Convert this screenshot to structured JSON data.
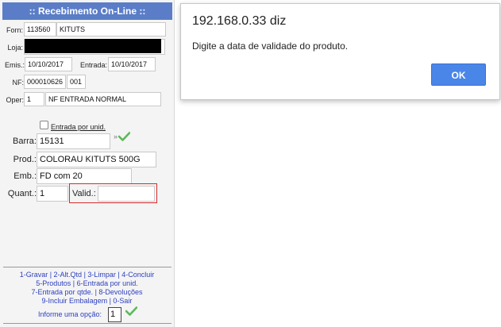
{
  "window": {
    "title": ":: Recebimento On-Line ::"
  },
  "header": {
    "forn_label": "Forn:",
    "forn_code": "113560",
    "forn_name": "KITUTS",
    "loja_label": "Loja:",
    "emis_label": "Emis.:",
    "emis_value": "10/10/2017",
    "entrada_label": "Entrada:",
    "entrada_value": "10/10/2017",
    "nf_label": "NF:",
    "nf_value": "000010626",
    "nf_serie": "001",
    "oper_label": "Oper:",
    "oper_code": "1",
    "oper_name": "NF ENTRADA NORMAL"
  },
  "form": {
    "entrada_unid_label": "Entrada por unid.",
    "entrada_unid_checked": false,
    "barra_label": "Barra:",
    "barra_value": "15131",
    "barra_marker": "»",
    "prod_label": "Prod.:",
    "prod_value": "COLORAU KITUTS 500G",
    "emb_label": "Emb.:",
    "emb_value": "FD com 20",
    "quant_label": "Quant.:",
    "quant_value": "1",
    "valid_label": "Valid.:",
    "valid_value": ""
  },
  "menu": {
    "line1": "1-Gravar | 2-Alt.Qtd | 3-Limpar | 4-Concluir",
    "line2": "5-Produtos | 6-Entrada por unid.",
    "line3": "7-Entrada por qtde. | 8-Devoluções",
    "line4": "9-Incluir Embalagem | 0-Sair",
    "prompt_label": "Informe uma opção:",
    "option_value": "1"
  },
  "dialog": {
    "title": "192.168.0.33 diz",
    "message": "Digite a data de validade do produto.",
    "ok_label": "OK"
  },
  "colors": {
    "title_bar": "#5b7dc7",
    "valid_border": "#d62b2b",
    "menu_text": "#2b3fbf",
    "ok_button": "#4a86e8",
    "check": "#5cb85c"
  },
  "icons": {
    "confirm": "check-icon"
  }
}
